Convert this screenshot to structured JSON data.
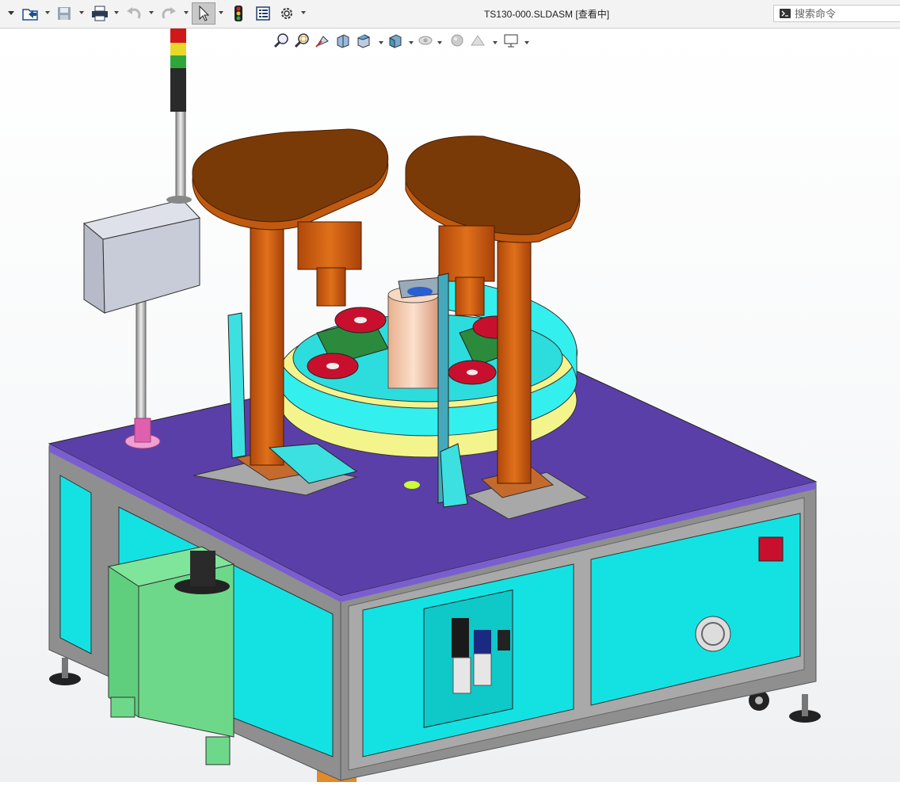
{
  "window": {
    "title": "TS130-000.SLDASM [查看中]"
  },
  "search": {
    "placeholder": "搜索命令"
  },
  "toolbar": {
    "icons": [
      "dropdown-arrow-icon",
      "open-icon",
      "save-icon",
      "print-icon",
      "undo-icon",
      "redo-icon",
      "select-icon",
      "traffic-light-icon",
      "file-properties-icon",
      "options-gear-icon"
    ]
  },
  "heads_up_toolbar": {
    "icons": [
      "zoom-to-fit-icon",
      "zoom-area-icon",
      "previous-view-icon",
      "section-view-icon",
      "view-orientation-icon",
      "display-style-icon",
      "hide-show-icon",
      "appearance-icon",
      "scene-icon",
      "view-settings-icon"
    ]
  },
  "model": {
    "name": "TS130-000",
    "colors": {
      "tabletop": "#5b3fa8",
      "panels": "#16e6e6",
      "frame": "#9a9a9a",
      "arms": "#d2620c",
      "tank": "#6ed88a",
      "ring_cyan": "#33f0ee",
      "ring_yellow": "#f4f48c",
      "cylinder": "#f5c8a8",
      "control_box": "#c8cbd8",
      "wheel_red": "#c8102e"
    }
  }
}
